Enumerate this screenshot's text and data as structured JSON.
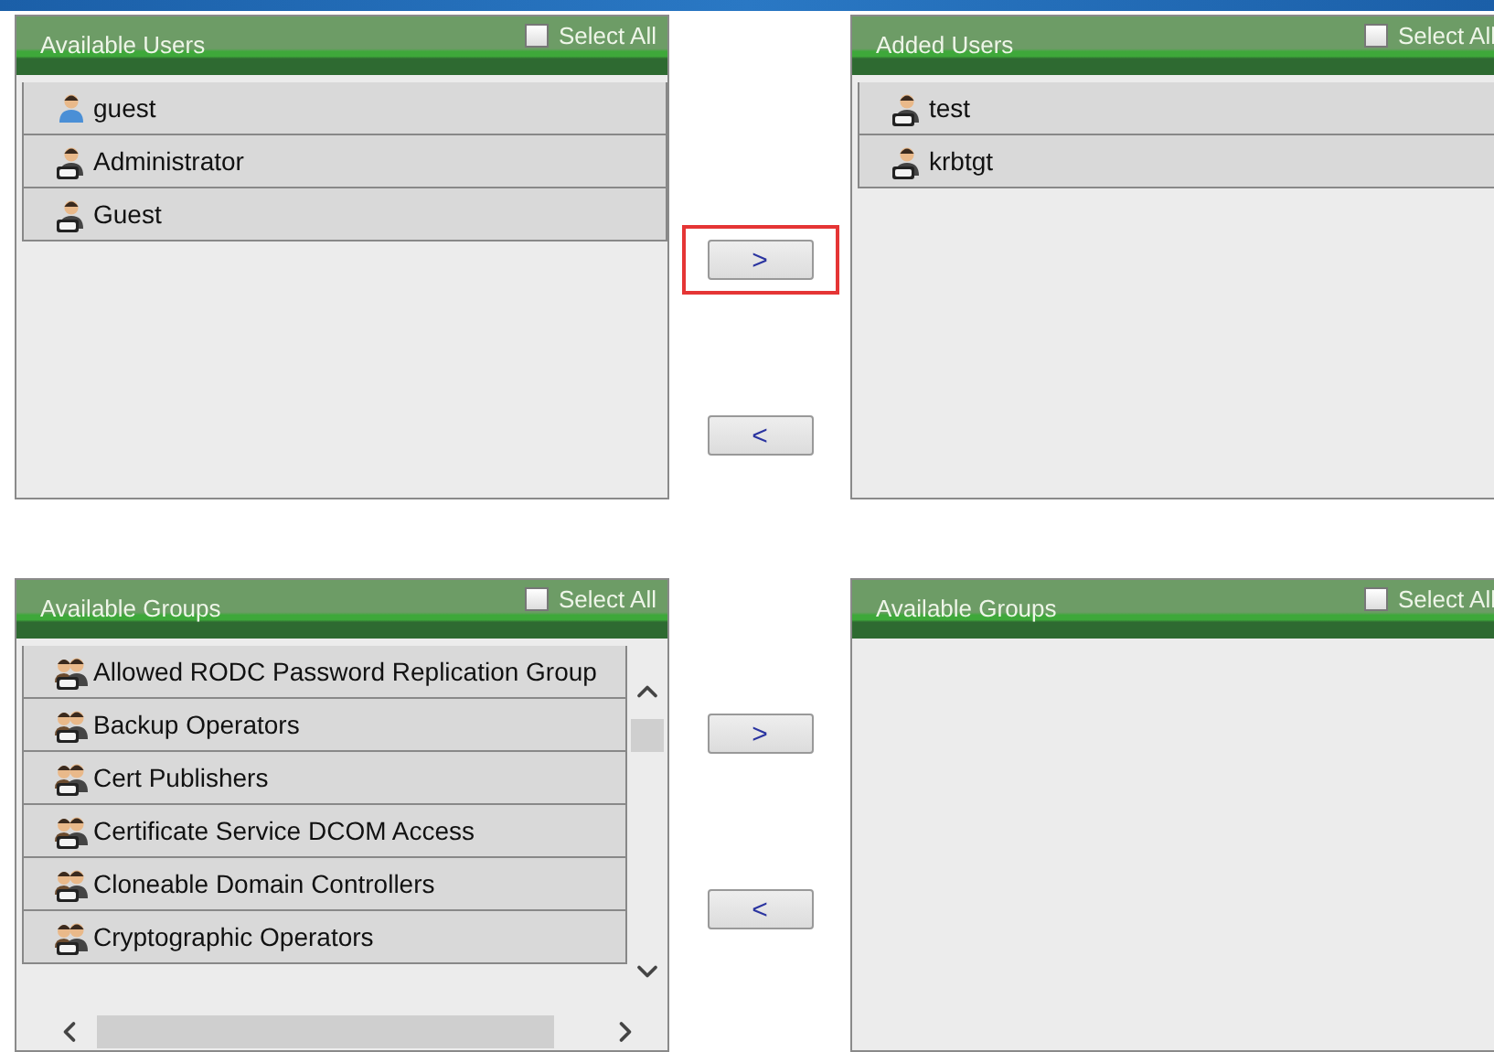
{
  "sections": [
    {
      "available": {
        "title": "Available Users",
        "select_all": {
          "label": "Select All",
          "checked": false
        },
        "scrollbars": false,
        "items": [
          {
            "label": "guest",
            "kind": "local-user"
          },
          {
            "label": "Administrator",
            "kind": "ad-user"
          },
          {
            "label": "Guest",
            "kind": "ad-user"
          }
        ]
      },
      "move_buttons": [
        {
          "label": ">",
          "highlighted": true
        },
        {
          "label": "<",
          "highlighted": false
        }
      ],
      "added": {
        "title": "Added Users",
        "select_all": {
          "label": "Select All",
          "checked": false
        },
        "scrollbars": false,
        "items": [
          {
            "label": "test",
            "kind": "ad-user"
          },
          {
            "label": "krbtgt",
            "kind": "ad-user"
          }
        ]
      }
    },
    {
      "available": {
        "title": "Available Groups",
        "select_all": {
          "label": "Select All",
          "checked": false
        },
        "scrollbars": true,
        "items": [
          {
            "label": "Allowed RODC Password Replication Group",
            "kind": "ad-group"
          },
          {
            "label": "Backup Operators",
            "kind": "ad-group"
          },
          {
            "label": "Cert Publishers",
            "kind": "ad-group"
          },
          {
            "label": "Certificate Service DCOM Access",
            "kind": "ad-group"
          },
          {
            "label": "Cloneable Domain Controllers",
            "kind": "ad-group"
          },
          {
            "label": "Cryptographic Operators",
            "kind": "ad-group"
          }
        ]
      },
      "move_buttons": [
        {
          "label": ">",
          "highlighted": false
        },
        {
          "label": "<",
          "highlighted": false
        }
      ],
      "added": {
        "title": "Available Groups",
        "select_all": {
          "label": "Select All",
          "checked": false
        },
        "scrollbars": false
      }
    }
  ]
}
